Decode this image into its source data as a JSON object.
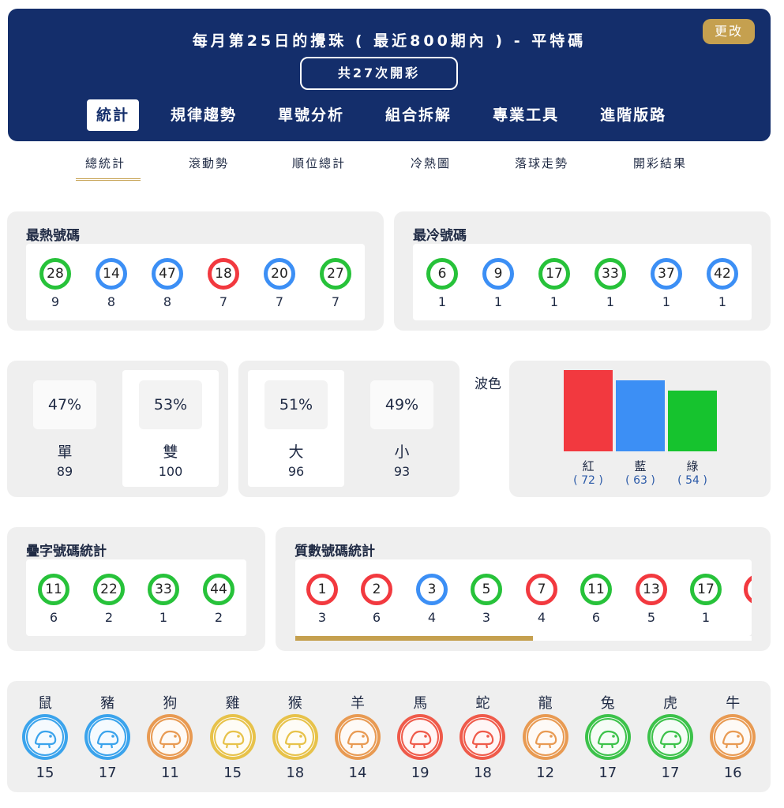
{
  "header": {
    "title": "每月第25日的攪珠 ( 最近800期內 ) - 平特碼",
    "change_label": "更改",
    "count_label": "共27次開彩",
    "tabs": [
      "統計",
      "規律趨勢",
      "單號分析",
      "組合拆解",
      "專業工具",
      "進階版路"
    ]
  },
  "subtabs": [
    "總統計",
    "滾動勢",
    "順位總計",
    "冷熱圖",
    "落球走勢",
    "開彩結果"
  ],
  "hot": {
    "title": "最熱號碼",
    "balls": [
      {
        "num": "28",
        "color": "green",
        "count": "9"
      },
      {
        "num": "14",
        "color": "blue",
        "count": "8"
      },
      {
        "num": "47",
        "color": "blue",
        "count": "8"
      },
      {
        "num": "18",
        "color": "red",
        "count": "7"
      },
      {
        "num": "20",
        "color": "blue",
        "count": "7"
      },
      {
        "num": "27",
        "color": "green",
        "count": "7"
      }
    ]
  },
  "cold": {
    "title": "最冷號碼",
    "balls": [
      {
        "num": "6",
        "color": "green",
        "count": "1"
      },
      {
        "num": "9",
        "color": "blue",
        "count": "1"
      },
      {
        "num": "17",
        "color": "green",
        "count": "1"
      },
      {
        "num": "33",
        "color": "green",
        "count": "1"
      },
      {
        "num": "37",
        "color": "blue",
        "count": "1"
      },
      {
        "num": "42",
        "color": "blue",
        "count": "1"
      }
    ]
  },
  "odd_even": [
    {
      "pct": "47%",
      "label": "單",
      "count": "89"
    },
    {
      "pct": "53%",
      "label": "雙",
      "count": "100"
    }
  ],
  "big_small": [
    {
      "pct": "51%",
      "label": "大",
      "count": "96"
    },
    {
      "pct": "49%",
      "label": "小",
      "count": "93"
    }
  ],
  "wave": {
    "label": "波色",
    "bars": [
      {
        "name": "紅",
        "value": "( 72 )",
        "count": 72,
        "color": "#f2393f"
      },
      {
        "name": "藍",
        "value": "( 63 )",
        "count": 63,
        "color": "#3c8ff5"
      },
      {
        "name": "綠",
        "value": "( 54 )",
        "count": 54,
        "color": "#16c32e"
      }
    ]
  },
  "repeat": {
    "title": "疊字號碼統計",
    "balls": [
      {
        "num": "11",
        "color": "green",
        "count": "6"
      },
      {
        "num": "22",
        "color": "green",
        "count": "2"
      },
      {
        "num": "33",
        "color": "green",
        "count": "1"
      },
      {
        "num": "44",
        "color": "green",
        "count": "2"
      }
    ]
  },
  "prime": {
    "title": "質數號碼統計",
    "scroll_progress": 0.52,
    "balls": [
      {
        "num": "1",
        "color": "red",
        "count": "3"
      },
      {
        "num": "2",
        "color": "red",
        "count": "6"
      },
      {
        "num": "3",
        "color": "blue",
        "count": "4"
      },
      {
        "num": "5",
        "color": "green",
        "count": "3"
      },
      {
        "num": "7",
        "color": "red",
        "count": "4"
      },
      {
        "num": "11",
        "color": "green",
        "count": "6"
      },
      {
        "num": "13",
        "color": "red",
        "count": "5"
      },
      {
        "num": "17",
        "color": "green",
        "count": "1"
      }
    ]
  },
  "zodiac": [
    {
      "name": "鼠",
      "count": "15",
      "icon": "rat-icon",
      "color": "#3aa3ec"
    },
    {
      "name": "豬",
      "count": "17",
      "icon": "pig-icon",
      "color": "#3aa3ec"
    },
    {
      "name": "狗",
      "count": "11",
      "icon": "dog-icon",
      "color": "#e89a52"
    },
    {
      "name": "雞",
      "count": "15",
      "icon": "rooster-icon",
      "color": "#e7c24a"
    },
    {
      "name": "猴",
      "count": "18",
      "icon": "monkey-icon",
      "color": "#e7c24a"
    },
    {
      "name": "羊",
      "count": "14",
      "icon": "goat-icon",
      "color": "#e89a52"
    },
    {
      "name": "馬",
      "count": "19",
      "icon": "horse-icon",
      "color": "#ef5a4a"
    },
    {
      "name": "蛇",
      "count": "18",
      "icon": "snake-icon",
      "color": "#ef5a4a"
    },
    {
      "name": "龍",
      "count": "12",
      "icon": "dragon-icon",
      "color": "#e89a52"
    },
    {
      "name": "兔",
      "count": "17",
      "icon": "rabbit-icon",
      "color": "#3cc24a"
    },
    {
      "name": "虎",
      "count": "17",
      "icon": "tiger-icon",
      "color": "#3cc24a"
    },
    {
      "name": "牛",
      "count": "16",
      "icon": "ox-icon",
      "color": "#e89a52"
    }
  ]
}
